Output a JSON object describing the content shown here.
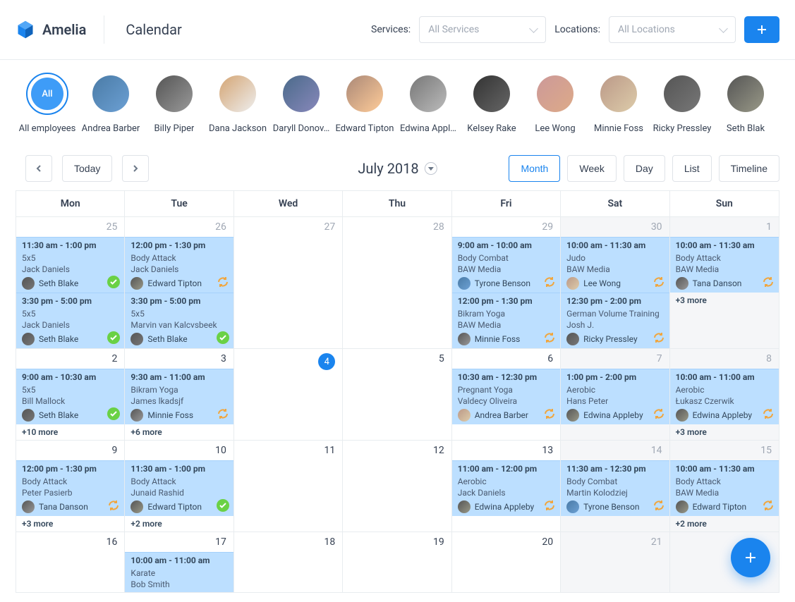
{
  "brand": "Amelia",
  "page_title": "Calendar",
  "filters": {
    "services_label": "Services:",
    "services_placeholder": "All Services",
    "locations_label": "Locations:",
    "locations_placeholder": "All Locations"
  },
  "employees": {
    "all_label": "All",
    "all_caption": "All employees",
    "list": [
      {
        "name": "Andrea Barber"
      },
      {
        "name": "Billy Piper"
      },
      {
        "name": "Dana Jackson"
      },
      {
        "name": "Daryll Donov…"
      },
      {
        "name": "Edward Tipton"
      },
      {
        "name": "Edwina Appl…"
      },
      {
        "name": "Kelsey Rake"
      },
      {
        "name": "Lee Wong"
      },
      {
        "name": "Minnie Foss"
      },
      {
        "name": "Ricky Pressley"
      },
      {
        "name": "Seth Blak"
      }
    ]
  },
  "controls": {
    "today": "Today",
    "current_period": "July 2018",
    "views": {
      "month": "Month",
      "week": "Week",
      "day": "Day",
      "list": "List",
      "timeline": "Timeline"
    }
  },
  "weekdays": [
    "Mon",
    "Tue",
    "Wed",
    "Thu",
    "Fri",
    "Sat",
    "Sun"
  ],
  "grid": [
    [
      {
        "num": "25",
        "prev": true,
        "events": [
          {
            "time": "11:30 am - 1:00 pm",
            "title": "5x5",
            "subtitle": "Jack Daniels",
            "assignee": "Seth Blake",
            "status": "green"
          },
          {
            "time": "3:30 pm - 5:00 pm",
            "title": "5x5",
            "subtitle": "Jack Daniels",
            "assignee": "Seth Blake",
            "status": "green"
          }
        ]
      },
      {
        "num": "26",
        "prev": true,
        "events": [
          {
            "time": "12:00 pm - 1:30 pm",
            "title": "Body Attack",
            "subtitle": "Jack Daniels",
            "assignee": "Edward Tipton",
            "status": "sync"
          },
          {
            "time": "3:30 pm - 5:00 pm",
            "title": "5x5",
            "subtitle": "Marvin van Kalcvsbeek",
            "assignee": "Seth Blake",
            "status": "green"
          }
        ]
      },
      {
        "num": "27",
        "prev": true,
        "events": []
      },
      {
        "num": "28",
        "prev": true,
        "events": []
      },
      {
        "num": "29",
        "prev": true,
        "events": [
          {
            "time": "9:00 am - 10:00 am",
            "title": "Body Combat",
            "subtitle": "BAW Media",
            "assignee": "Tyrone Benson",
            "status": "sync"
          },
          {
            "time": "12:00 pm - 1:30 pm",
            "title": "Bikram Yoga",
            "subtitle": "BAW Media",
            "assignee": "Minnie Foss",
            "status": "sync"
          }
        ]
      },
      {
        "num": "30",
        "prev": true,
        "weekend": true,
        "events": [
          {
            "time": "10:00 am - 11:30 am",
            "title": "Judo",
            "subtitle": "BAW Media",
            "assignee": "Lee Wong",
            "status": "sync"
          },
          {
            "time": "12:30 pm - 2:00 pm",
            "title": "German Volume Training",
            "subtitle": "Josh J.",
            "assignee": "Ricky Pressley",
            "status": "sync"
          }
        ]
      },
      {
        "num": "1",
        "weekend": true,
        "events": [
          {
            "time": "10:00 am - 11:30 am",
            "title": "Body Attack",
            "subtitle": "BAW Media",
            "assignee": "Tana Danson",
            "status": "sync"
          }
        ],
        "more": "+3 more"
      }
    ],
    [
      {
        "num": "2",
        "events": [
          {
            "time": "9:00 am - 10:30 am",
            "title": "5x5",
            "subtitle": "Bill Mallock",
            "assignee": "Seth Blake",
            "status": "green"
          }
        ],
        "more": "+10 more"
      },
      {
        "num": "3",
        "events": [
          {
            "time": "9:30 am - 11:00 am",
            "title": "Bikram Yoga",
            "subtitle": "James lkadsjf",
            "assignee": "Minnie Foss",
            "status": "sync"
          }
        ],
        "more": "+6 more"
      },
      {
        "num": "4",
        "today": true,
        "events": []
      },
      {
        "num": "5",
        "events": []
      },
      {
        "num": "6",
        "events": [
          {
            "time": "10:30 am - 12:30 pm",
            "title": "Pregnant Yoga",
            "subtitle": "Valdecy Oliveira",
            "assignee": "Andrea Barber",
            "status": "sync"
          }
        ]
      },
      {
        "num": "7",
        "weekend": true,
        "events": [
          {
            "time": "1:00 pm - 2:00 pm",
            "title": "Aerobic",
            "subtitle": "Hans Peter",
            "assignee": "Edwina Appleby",
            "status": "sync"
          }
        ]
      },
      {
        "num": "8",
        "weekend": true,
        "events": [
          {
            "time": "10:00 am - 11:00 am",
            "title": "Aerobic",
            "subtitle": "Łukasz Czerwik",
            "assignee": "Edwina Appleby",
            "status": "sync"
          }
        ],
        "more": "+3 more"
      }
    ],
    [
      {
        "num": "9",
        "events": [
          {
            "time": "12:00 pm - 1:30 pm",
            "title": "Body Attack",
            "subtitle": "Peter Pasierb",
            "assignee": "Tana Danson",
            "status": "sync"
          }
        ],
        "more": "+3 more"
      },
      {
        "num": "10",
        "events": [
          {
            "time": "11:30 am - 1:00 pm",
            "title": "Body Attack",
            "subtitle": "Junaid Rashid",
            "assignee": "Edward Tipton",
            "status": "green"
          }
        ],
        "more": "+2 more"
      },
      {
        "num": "11",
        "events": []
      },
      {
        "num": "12",
        "events": []
      },
      {
        "num": "13",
        "events": [
          {
            "time": "11:00 am - 12:00 pm",
            "title": "Aerobic",
            "subtitle": "Jack Daniels",
            "assignee": "Edwina Appleby",
            "status": "sync"
          }
        ]
      },
      {
        "num": "14",
        "weekend": true,
        "events": [
          {
            "time": "11:30 am - 12:30 pm",
            "title": "Body Combat",
            "subtitle": "Martin Kolodziej",
            "assignee": "Tyrone Benson",
            "status": "sync"
          }
        ]
      },
      {
        "num": "15",
        "weekend": true,
        "events": [
          {
            "time": "10:00 am - 11:30 am",
            "title": "Body Attack",
            "subtitle": "BAW Media",
            "assignee": "Edward Tipton",
            "status": "sync"
          }
        ],
        "more": "+2 more"
      }
    ],
    [
      {
        "num": "16",
        "events": []
      },
      {
        "num": "17",
        "events": [
          {
            "time": "10:00 am - 11:00 am",
            "title": "Karate",
            "subtitle": "Bob Smith"
          }
        ]
      },
      {
        "num": "18",
        "events": []
      },
      {
        "num": "19",
        "events": []
      },
      {
        "num": "20",
        "events": []
      },
      {
        "num": "21",
        "weekend": true,
        "events": []
      },
      {
        "num": "",
        "weekend": true,
        "events": []
      }
    ]
  ]
}
